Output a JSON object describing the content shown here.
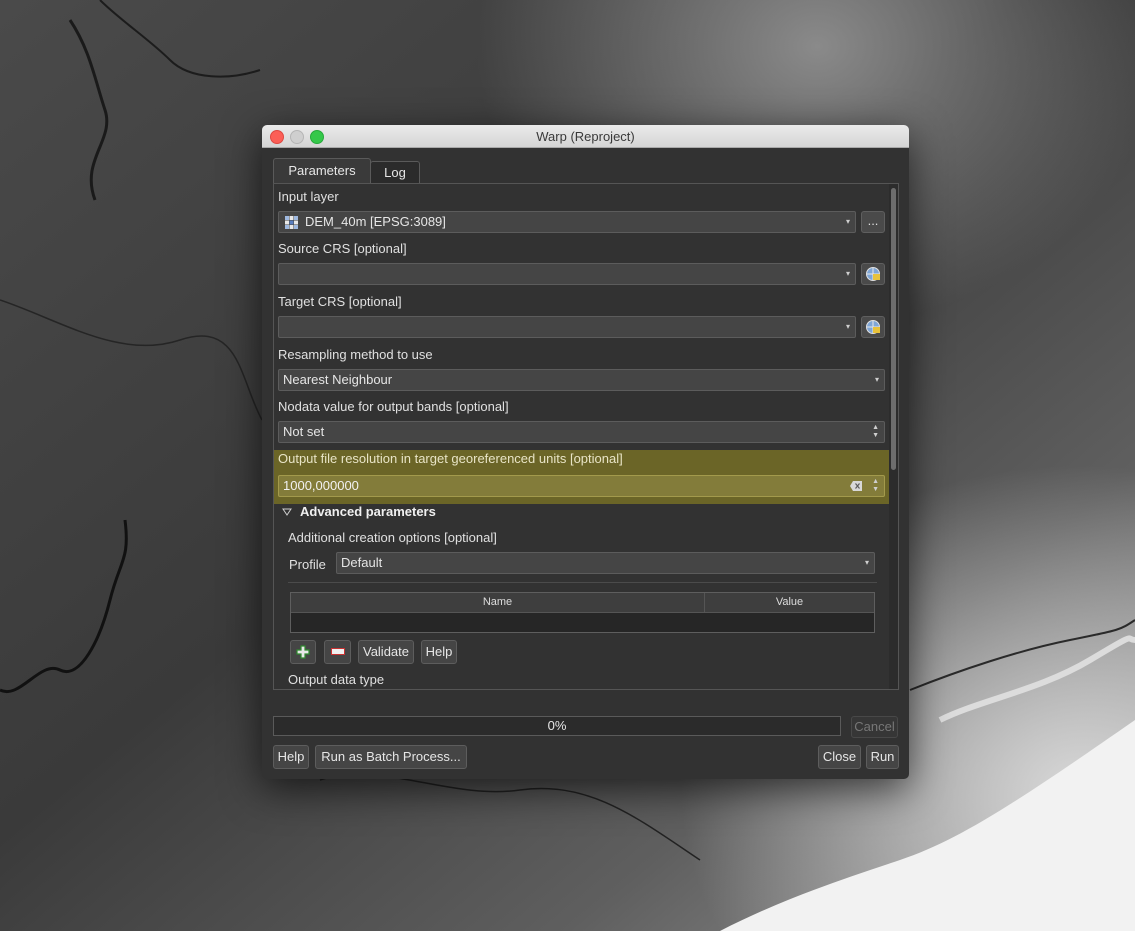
{
  "window": {
    "title": "Warp (Reproject)"
  },
  "tabs": [
    {
      "label": "Parameters"
    },
    {
      "label": "Log"
    }
  ],
  "params": {
    "input_layer": {
      "label": "Input layer",
      "value": "DEM_40m [EPSG:3089]",
      "browse_label": "..."
    },
    "source_crs": {
      "label": "Source CRS [optional]",
      "value": ""
    },
    "target_crs": {
      "label": "Target CRS [optional]",
      "value": ""
    },
    "resampling": {
      "label": "Resampling method to use",
      "value": "Nearest Neighbour"
    },
    "nodata": {
      "label": "Nodata value for output bands [optional]",
      "value": "Not set"
    },
    "resolution": {
      "label": "Output file resolution in target georeferenced units [optional]",
      "value": "1000,000000"
    }
  },
  "advanced": {
    "title": "Advanced parameters",
    "creation_options_label": "Additional creation options [optional]",
    "profile_label": "Profile",
    "profile_value": "Default",
    "table_columns": [
      "Name",
      "Value"
    ],
    "validate_label": "Validate",
    "help_label": "Help",
    "output_type_label": "Output data type"
  },
  "progress": {
    "percent": 0,
    "label": "0%"
  },
  "buttons": {
    "cancel": "Cancel",
    "help": "Help",
    "batch": "Run as Batch Process...",
    "close": "Close",
    "run": "Run"
  },
  "colors": {
    "highlight": "#6b6527",
    "dialog_bg": "#323232"
  }
}
